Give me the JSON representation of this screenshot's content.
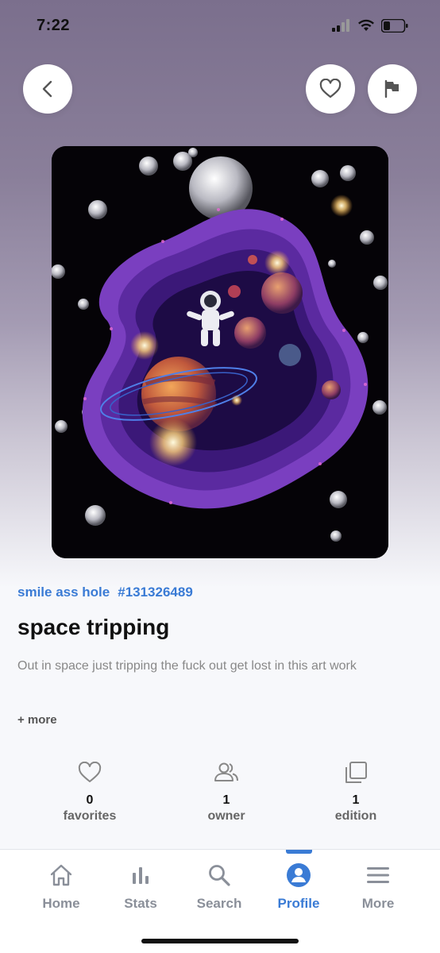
{
  "status_bar": {
    "time": "7:22"
  },
  "artwork": {
    "alt_icon": "space-artwork-image"
  },
  "nft": {
    "creator": "smile ass hole",
    "token_id": "#131326489",
    "title": "space tripping",
    "description": "Out in space just tripping the fuck out get lost in this art work",
    "more_label": "+ more"
  },
  "stats": [
    {
      "count": "0",
      "label": "favorites",
      "icon": "heart-icon"
    },
    {
      "count": "1",
      "label": "owner",
      "icon": "people-icon"
    },
    {
      "count": "1",
      "label": "edition",
      "icon": "copies-icon"
    }
  ],
  "tabs": [
    {
      "label": "Home",
      "icon": "home-icon"
    },
    {
      "label": "Stats",
      "icon": "bar-chart-icon"
    },
    {
      "label": "Search",
      "icon": "search-icon"
    },
    {
      "label": "Profile",
      "icon": "profile-icon"
    },
    {
      "label": "More",
      "icon": "menu-icon"
    }
  ],
  "colors": {
    "accent": "#3a7bd5",
    "inactive": "#8a8f99"
  }
}
